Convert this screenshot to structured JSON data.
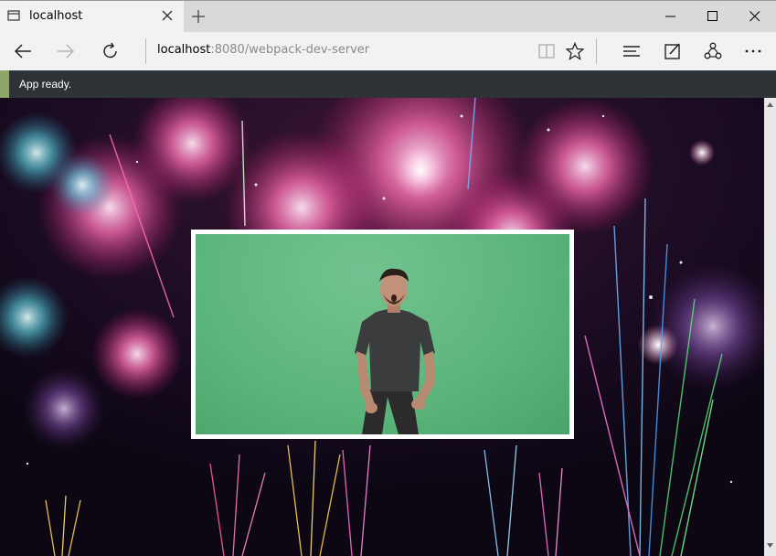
{
  "browser": {
    "tab": {
      "title": "localhost"
    },
    "address": {
      "host": "localhost",
      "rest": ":8080/webpack-dev-server"
    },
    "icons": {
      "back": "back-arrow-icon",
      "forward": "forward-arrow-icon",
      "refresh": "refresh-icon",
      "reading": "reading-view-icon",
      "favorite": "star-icon",
      "hub": "hub-icon",
      "note": "web-note-icon",
      "share": "share-icon",
      "more": "more-icon"
    }
  },
  "notification": {
    "text": "App ready.",
    "accent": "#8ea767"
  },
  "colors": {
    "notice_bg": "#2e3338",
    "greenscreen": "#5db67c",
    "background": "#150a1c"
  }
}
